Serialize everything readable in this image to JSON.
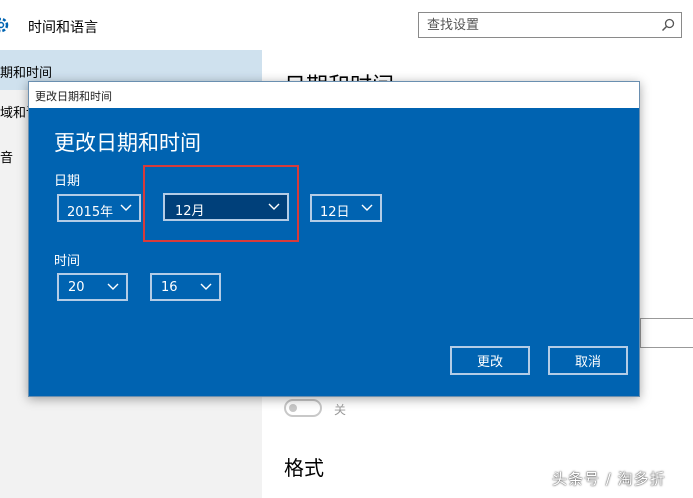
{
  "app": {
    "title": "时间和语言",
    "icon": "gear-icon"
  },
  "search": {
    "placeholder": "查找设置",
    "icon": "search-icon"
  },
  "sidebar": {
    "items": [
      {
        "label": "期和时间",
        "active": true
      },
      {
        "label": "域和语"
      },
      {
        "label": "音"
      }
    ]
  },
  "main": {
    "heading": "日期和时间",
    "toggle_label": "关",
    "format_heading": "格式"
  },
  "dialog": {
    "window_title": "更改日期和时间",
    "heading": "更改日期和时间",
    "date_label": "日期",
    "time_label": "时间",
    "year": "2015年",
    "month": "12月",
    "day": "12日",
    "hour": "20",
    "minute": "16",
    "change_button": "更改",
    "cancel_button": "取消"
  },
  "watermark": "头条号 / 淘多折",
  "colors": {
    "dialog_bg": "#0063b1",
    "selected_combo_bg": "#00407a",
    "highlight_border": "#d83b3b",
    "sidebar_active": "#cfe1ee"
  }
}
